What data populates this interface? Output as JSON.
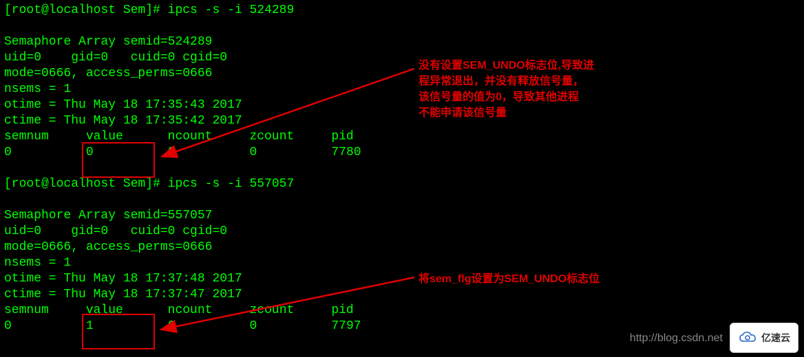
{
  "prompt": "[root@localhost Sem]#",
  "cmd1": "ipcs -s -i 524289",
  "cmd2": "ipcs -s -i 557057",
  "block1": {
    "title": "Semaphore Array semid=524289",
    "l1": "uid=0\t gid=0\t cuid=0\tcgid=0",
    "l2": "mode=0666, access_perms=0666",
    "l3": "nsems = 1",
    "l4": "otime = Thu May 18 17:35:43 2017",
    "l5": "ctime = Thu May 18 17:35:42 2017",
    "header": {
      "c1": "semnum",
      "c2": "value",
      "c3": "ncount",
      "c4": "zcount",
      "c5": "pid"
    },
    "row": {
      "c1": "0",
      "c2": "0",
      "c3": "0",
      "c4": "0",
      "c5": "7780"
    }
  },
  "block2": {
    "title": "Semaphore Array semid=557057",
    "l1": "uid=0\t gid=0\t cuid=0\tcgid=0",
    "l2": "mode=0666, access_perms=0666",
    "l3": "nsems = 1",
    "l4": "otime = Thu May 18 17:37:48 2017",
    "l5": "ctime = Thu May 18 17:37:47 2017",
    "header": {
      "c1": "semnum",
      "c2": "value",
      "c3": "ncount",
      "c4": "zcount",
      "c5": "pid"
    },
    "row": {
      "c1": "0",
      "c2": "1",
      "c3": "0",
      "c4": "0",
      "c5": "7797"
    }
  },
  "annotations": {
    "a1_l1": "没有设置SEM_UNDO标志位,导致进",
    "a1_l2": "程异常退出，并没有释放信号量，",
    "a1_l3": "该信号量的值为0，导致其他进程",
    "a1_l4": "不能申请该信号量",
    "a2": "将sem_flg设置为SEM_UNDO标志位"
  },
  "watermark": "http://blog.csdn.net",
  "logo_text": "亿速云",
  "colors": {
    "terminal_green": "#00ff00",
    "highlight_red": "#e10000",
    "bg_black": "#000000"
  }
}
